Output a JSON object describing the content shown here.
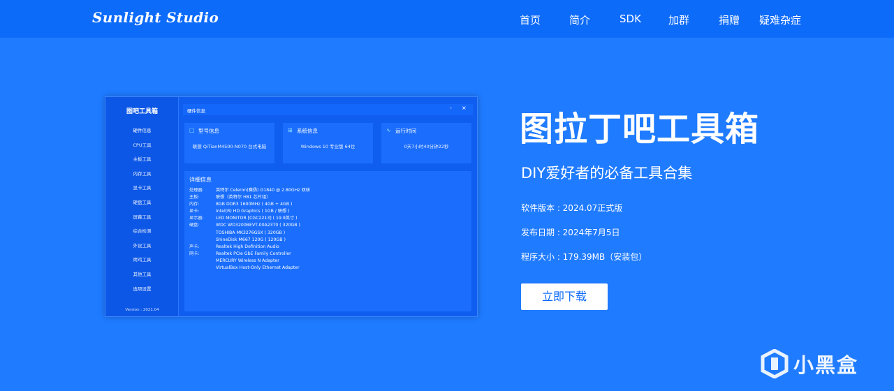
{
  "header": {
    "logo": "Sunlight Studio",
    "nav": [
      "首页",
      "简介",
      "SDK",
      "加群",
      "捐赠",
      "疑难杂症"
    ]
  },
  "app": {
    "title": "图吧工具箱",
    "sidebar": [
      "硬件信息",
      "CPU工具",
      "主板工具",
      "内存工具",
      "显卡工具",
      "硬盘工具",
      "屏幕工具",
      "综合检测",
      "外设工具",
      "烤鸡工具",
      "其他工具",
      "选项设置"
    ],
    "version": "Version : 2021.04",
    "window_title": "硬件信息",
    "window_controls": [
      "-",
      "×"
    ],
    "cards": [
      {
        "icon": "monitor-icon",
        "label": "型号信息",
        "value": "联想 QiTianM4500-N070 台式电脑"
      },
      {
        "icon": "windows-icon",
        "label": "系统信息",
        "value": "Windows 10 专业版 64位"
      },
      {
        "icon": "pulse-icon",
        "label": "运行时间",
        "value": "0天7小时40分钟22秒"
      }
    ],
    "detail_title": "详细信息",
    "detail_rows": [
      {
        "key": "处理器:",
        "value": "英特尔 Celeron(赛扬) G1840 @ 2.80GHz 双核"
      },
      {
        "key": "主板:",
        "value": "联想（英特尔 H81 芯片组）"
      },
      {
        "key": "内存:",
        "value": "8GB DDR3 1600MHz ( 4GB + 4GB )"
      },
      {
        "key": "显卡:",
        "value": "Intel(R) HD Graphics ( 1GB / 联想 )"
      },
      {
        "key": "显示器:",
        "value": "LED MONITOR [CGC2213] ( 19.9英寸 )"
      },
      {
        "key": "硬盘:",
        "value": "WDC WD3200BEVT-00A23T0 ( 320GB )"
      },
      {
        "key": "",
        "value": "TOSHIBA MK3276GSX ( 320GB )"
      },
      {
        "key": "",
        "value": "ShineDisk M667 120G ( 120GB )"
      },
      {
        "key": "声卡:",
        "value": "Realtek High Definition Audio"
      },
      {
        "key": "网卡:",
        "value": "Realtek PCIe GbE Family Controller"
      },
      {
        "key": "",
        "value": "MERCURY Wireless N Adapter"
      },
      {
        "key": "",
        "value": "VirtualBox Host-Only Ethernet Adapter"
      }
    ]
  },
  "hero": {
    "title": "图拉丁吧工具箱",
    "subtitle": "DIY爱好者的必备工具合集",
    "version": "软件版本 : 2024.07正式版",
    "release_date": "发布日期 : 2024年7月5日",
    "size": "程序大小 : 179.39MB（安装包）",
    "download_label": "立即下载"
  },
  "watermark": {
    "text": "小黑盒"
  },
  "colors": {
    "background": "#1f7bff",
    "header": "#0d6bfa",
    "button_text": "#0d6bfa"
  }
}
